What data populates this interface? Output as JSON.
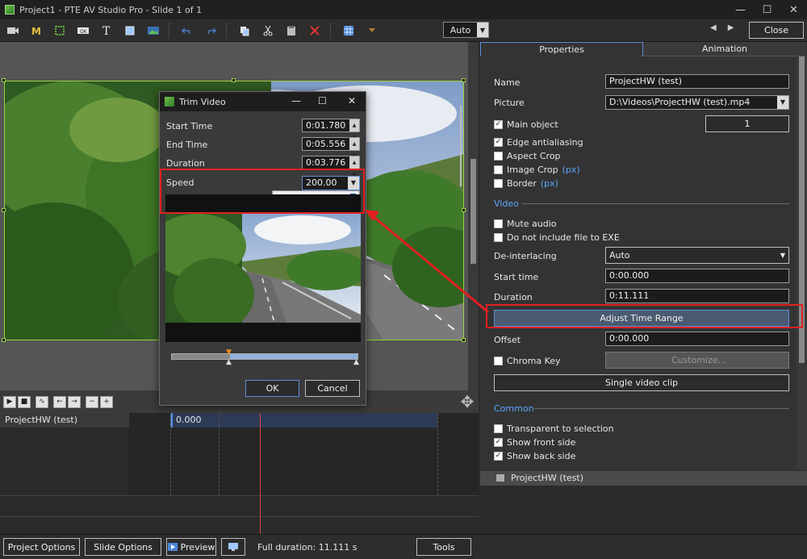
{
  "window": {
    "title": "Project1 - PTE AV Studio Pro - Slide 1 of 1",
    "minimize": "—",
    "maximize": "☐",
    "close": "✕"
  },
  "toolbar": {
    "zoom_value": "Auto",
    "close_label": "Close",
    "prev": "◀",
    "next": "▶"
  },
  "tabs": [
    {
      "label": "Properties",
      "active": true
    },
    {
      "label": "Animation",
      "active": false
    }
  ],
  "properties": {
    "name_label": "Name",
    "name_value": "ProjectHW (test)",
    "picture_label": "Picture",
    "picture_value": "D:\\Videos\\ProjectHW (test).mp4",
    "main_object_label": "Main object",
    "main_object_number": "1",
    "edge_antialiasing_label": "Edge antialiasing",
    "aspect_crop_label": "Aspect Crop",
    "image_crop_label": "Image Crop",
    "border_label": "Border",
    "px": "(px)",
    "video_section": "Video",
    "mute_audio_label": "Mute audio",
    "no_exe_label": "Do not include file to EXE",
    "deinterlacing_label": "De-interlacing",
    "deinterlacing_value": "Auto",
    "start_time_label": "Start time",
    "start_time_value": "0:00.000",
    "duration_label": "Duration",
    "duration_value": "0:11.111",
    "adjust_time_range_label": "Adjust Time Range",
    "offset_label": "Offset",
    "offset_value": "0:00.000",
    "chroma_key_label": "Chroma Key",
    "customize_label": "Customize...",
    "single_video_clip_label": "Single video clip",
    "common_section": "Common",
    "transparent_label": "Transparent to selection",
    "show_front_label": "Show front side",
    "show_back_label": "Show back side"
  },
  "object_bar": {
    "label": "ProjectHW (test)"
  },
  "timeline": {
    "track_label": "ProjectHW (test)",
    "clip_time": "0.000"
  },
  "dialog": {
    "title": "Trim Video",
    "start_time_label": "Start Time",
    "start_time_value": "0:01.780",
    "end_time_label": "End Time",
    "end_time_value": "0:05.556",
    "duration_label": "Duration",
    "duration_value": "0:03.776",
    "speed_label": "Speed",
    "speed_value": "200.00",
    "ok_label": "OK",
    "cancel_label": "Cancel"
  },
  "bottom": {
    "project_options": "Project Options",
    "slide_options": "Slide Options",
    "preview": "Preview",
    "full_duration": "Full duration: 11.111 s",
    "tools": "Tools"
  },
  "colors": {
    "accent": "#5da7ff",
    "highlight": "#e02020",
    "selection": "#9ad13f"
  }
}
